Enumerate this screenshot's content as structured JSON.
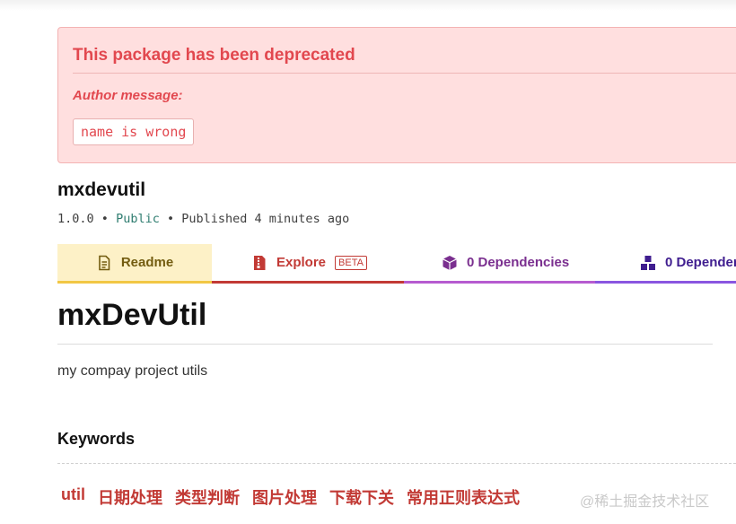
{
  "banner": {
    "title": "This package has been deprecated",
    "author_label": "Author message:",
    "message": "name is wrong"
  },
  "package": {
    "name": "mxdevutil",
    "version": "1.0.0",
    "visibility": "Public",
    "published": "Published 4 minutes ago",
    "separator": "•"
  },
  "tabs": {
    "readme": "Readme",
    "explore": "Explore",
    "explore_badge": "BETA",
    "dependencies": "0 Dependencies",
    "dependents": "0 Dependen"
  },
  "readme": {
    "title": "mxDevUtil",
    "description": "my compay project utils",
    "keywords_title": "Keywords",
    "keywords": [
      "util",
      "日期处理",
      "类型判断",
      "图片处理",
      "下载下关",
      "常用正则表达式"
    ]
  },
  "watermark": "@稀土掘金技术社区",
  "colors": {
    "danger": "#e2484f",
    "banner_bg": "#ffdfdf",
    "readme_tab": "#f2c744",
    "explore_tab": "#c23a35",
    "deps_tab": "#b65bd0",
    "dependents_tab": "#8a56e0"
  },
  "icons": {
    "readme": "document-icon",
    "explore": "file-zip-icon",
    "dependencies": "box-icon",
    "dependents": "boxes-icon"
  }
}
